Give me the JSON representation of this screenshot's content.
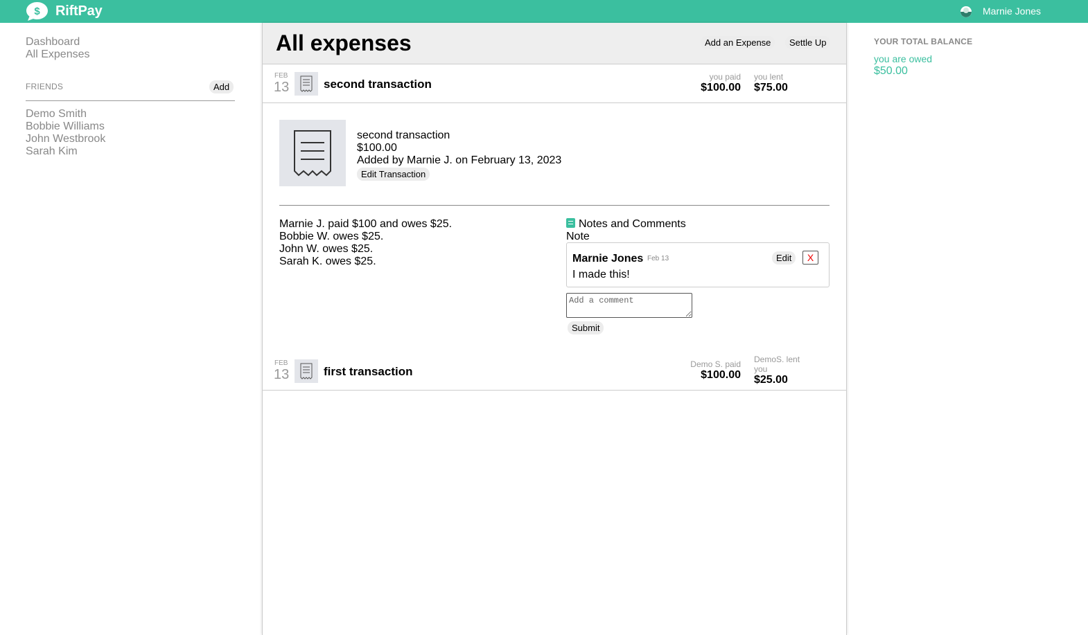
{
  "app": {
    "name": "RiftPay",
    "brand_color": "#3bbf9f"
  },
  "topbar": {
    "user_name": "Marnie Jones",
    "logo_icon": "dollar-speech-bubble"
  },
  "sidebar": {
    "nav": [
      {
        "label": "Dashboard"
      },
      {
        "label": "All Expenses"
      }
    ],
    "friends_label": "FRIENDS",
    "add_label": "Add",
    "friends": [
      "Demo Smith",
      "Bobbie Williams",
      "John Westbrook",
      "Sarah Kim"
    ]
  },
  "main": {
    "title": "All expenses",
    "add_expense_label": "Add an Expense",
    "settle_up_label": "Settle Up",
    "expenses": [
      {
        "month": "FEB",
        "day": "13",
        "title": "second transaction",
        "paid_label": "you paid",
        "paid_amount": "$100.00",
        "lent_label": "you lent",
        "lent_amount": "$75.00",
        "icon": "receipt-icon"
      },
      {
        "month": "FEB",
        "day": "13",
        "title": "first transaction",
        "paid_label": "Demo S. paid",
        "paid_amount": "$100.00",
        "lent_label": "DemoS. lent you",
        "lent_amount": "$25.00",
        "icon": "receipt-icon"
      }
    ],
    "detail": {
      "title": "second transaction",
      "amount": "$100.00",
      "added_by": "Added by Marnie J. on February 13, 2023",
      "edit_label": "Edit Transaction",
      "owes": [
        "Marnie J. paid $100 and owes $25.",
        "Bobbie W. owes $25.",
        "John W. owes $25.",
        "Sarah K. owes $25."
      ],
      "notes_heading": "Notes and Comments",
      "note_label": "Note",
      "comment": {
        "author": "Marnie Jones",
        "date": "Feb 13",
        "text": "I made this!",
        "edit_label": "Edit",
        "delete_label": "X"
      },
      "comment_placeholder": "Add a comment",
      "submit_label": "Submit"
    }
  },
  "balance": {
    "label": "YOUR TOTAL BALANCE",
    "status": "you are owed",
    "amount": "$50.00"
  }
}
